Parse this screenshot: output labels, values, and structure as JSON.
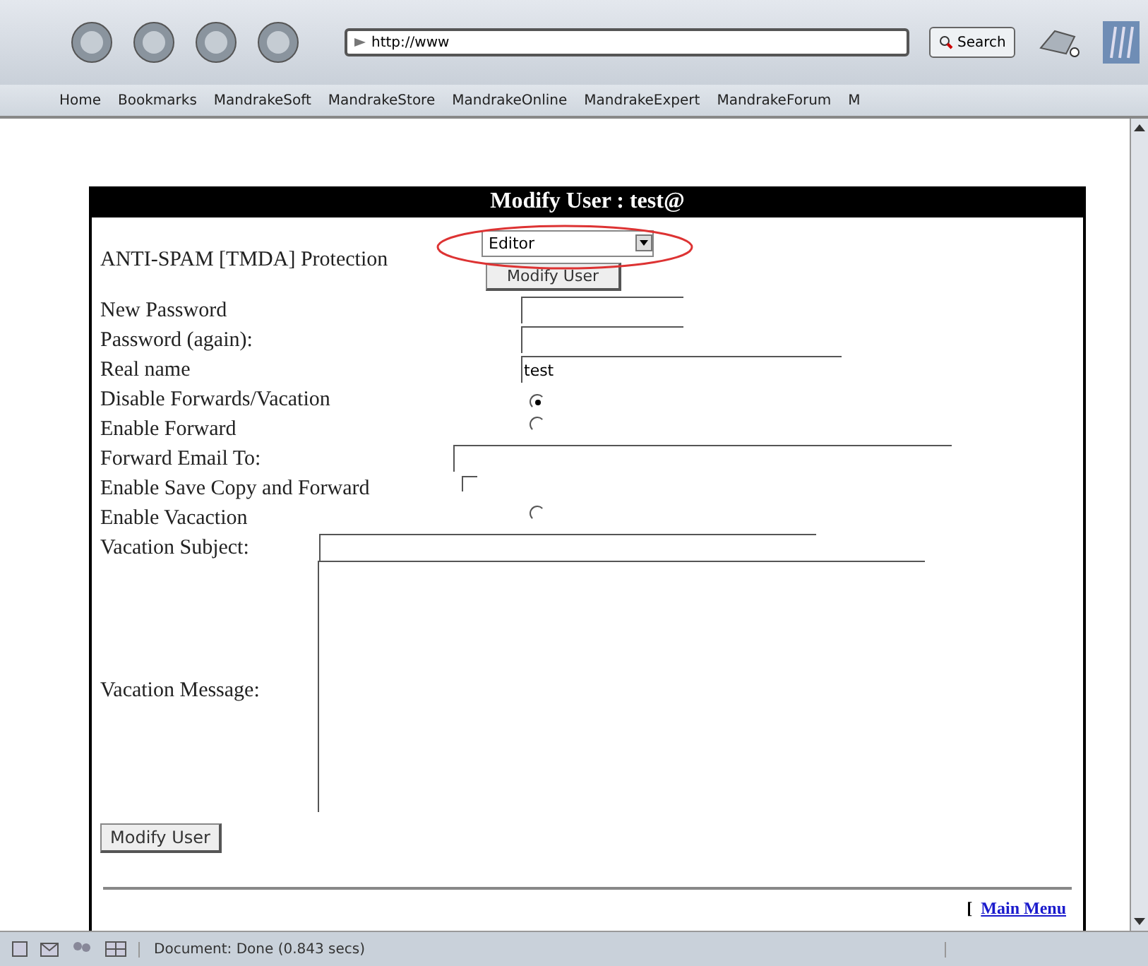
{
  "toolbar": {
    "url": "http://www",
    "search_button": "Search"
  },
  "bookmarks": [
    "Home",
    "Bookmarks",
    "MandrakeSoft",
    "MandrakeStore",
    "MandrakeOnline",
    "MandrakeExpert",
    "MandrakeForum",
    "M"
  ],
  "form": {
    "title": "Modify User : test@",
    "rows": [
      {
        "label": "ANTI-SPAM [TMDA] Protection",
        "kind": "select",
        "value": "Editor",
        "button": "Modify User"
      },
      {
        "label": "New Password",
        "kind": "text"
      },
      {
        "label": "Password (again):",
        "kind": "text"
      },
      {
        "label": "Real name",
        "kind": "text",
        "value": "test"
      },
      {
        "label": "Disable Forwards/Vacation",
        "kind": "radio",
        "checked": true
      },
      {
        "label": "Enable Forward",
        "kind": "radio",
        "checked": false
      },
      {
        "label": "Forward Email To:",
        "kind": "text"
      },
      {
        "label": "Enable Save Copy and Forward",
        "kind": "checkbox",
        "checked": false
      },
      {
        "label": "Enable Vacaction",
        "kind": "radio",
        "checked": false
      },
      {
        "label": "Vacation Subject:",
        "kind": "text"
      },
      {
        "label": "Vacation Message:",
        "kind": "textarea"
      }
    ],
    "submit": "Modify User",
    "bracket": "[",
    "main_menu_link": "Main Menu"
  },
  "status_bar": {
    "text": "Document: Done (0.843 secs)"
  }
}
